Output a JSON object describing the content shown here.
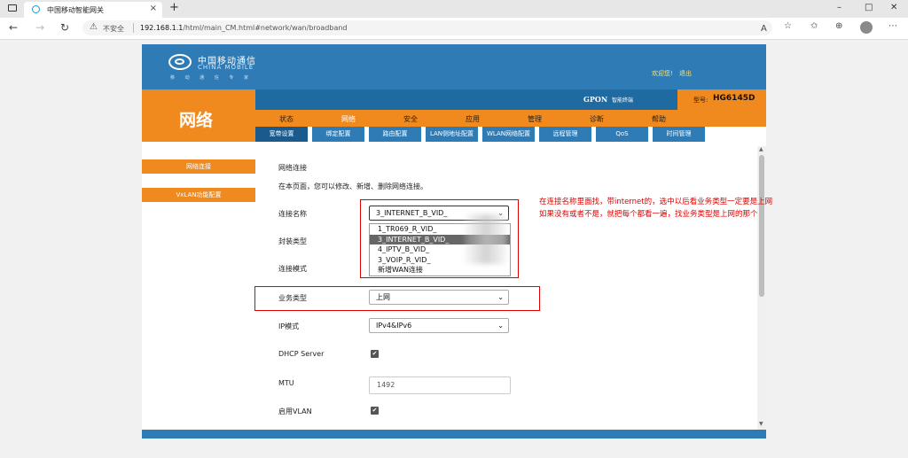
{
  "browser": {
    "tab_title": "中国移动智能网关",
    "tab_close": "×",
    "new_tab": "+",
    "security_label": "不安全",
    "url_host": "192.168.1.1",
    "url_path": "/html/main_CM.html#network/wan/broadband",
    "window_controls": [
      "–",
      "□",
      "✕"
    ],
    "nav_icons": [
      "back-icon",
      "forward-icon",
      "refresh-icon"
    ],
    "toolbar_icons": [
      "read-aloud-icon",
      "add-favorite-icon",
      "favorites-icon",
      "collections-icon",
      "profile-icon",
      "more-icon"
    ]
  },
  "header": {
    "brand_cn": "中国移动通信",
    "brand_en": "CHINA MOBILE",
    "brand_sub": "移 动 通 信 专 家",
    "welcome": "欢迎您!",
    "logout": "退出",
    "gpon": "GPON",
    "gpon_sub": "智能终端",
    "model_label": "型号:",
    "model_value": "HG6145D",
    "section_title": "网络",
    "accent_color": "#f08a1f",
    "primary_color": "#2e7bb5"
  },
  "main_nav": [
    "状态",
    "网络",
    "安全",
    "应用",
    "管理",
    "诊断",
    "帮助"
  ],
  "main_nav_active": "网络",
  "sub_nav": [
    "宽带设置",
    "绑定配置",
    "路由配置",
    "LAN侧地址配置",
    "WLAN网络配置",
    "远程管理",
    "QoS",
    "时间管理"
  ],
  "sub_nav_active": "宽带设置",
  "sidebar": [
    "网络连接",
    "VxLAN功能配置"
  ],
  "form": {
    "title": "网络连接",
    "description": "在本页面，您可以修改、新增、删除网络连接。",
    "connection_label": "连接名称",
    "connection_value": "3_INTERNET_B_VID_",
    "connection_options": [
      "1_TR069_R_VID_",
      "3_INTERNET_B_VID_",
      "4_IPTV_B_VID_",
      "3_VOIP_R_VID_",
      "新增WAN连接"
    ],
    "connection_selected_index": 1,
    "encap_label": "封装类型",
    "mode_label": "连接模式",
    "service_label": "业务类型",
    "service_value": "上网",
    "ip_mode_label": "IP模式",
    "ip_mode_value": "IPv4&IPv6",
    "dhcp_label": "DHCP Server",
    "dhcp_checked": "✔",
    "mtu_label": "MTU",
    "mtu_value": "1492",
    "vlan_label": "启用VLAN",
    "vlan_checked": "✔"
  },
  "annotation": {
    "line1": "在连接名称里面找，带internet的，选中以后看业务类型一定要是上网",
    "line2": "如果没有或者不是，就把每个都看一遍，找业务类型是上网的那个",
    "color": "#e00000"
  }
}
